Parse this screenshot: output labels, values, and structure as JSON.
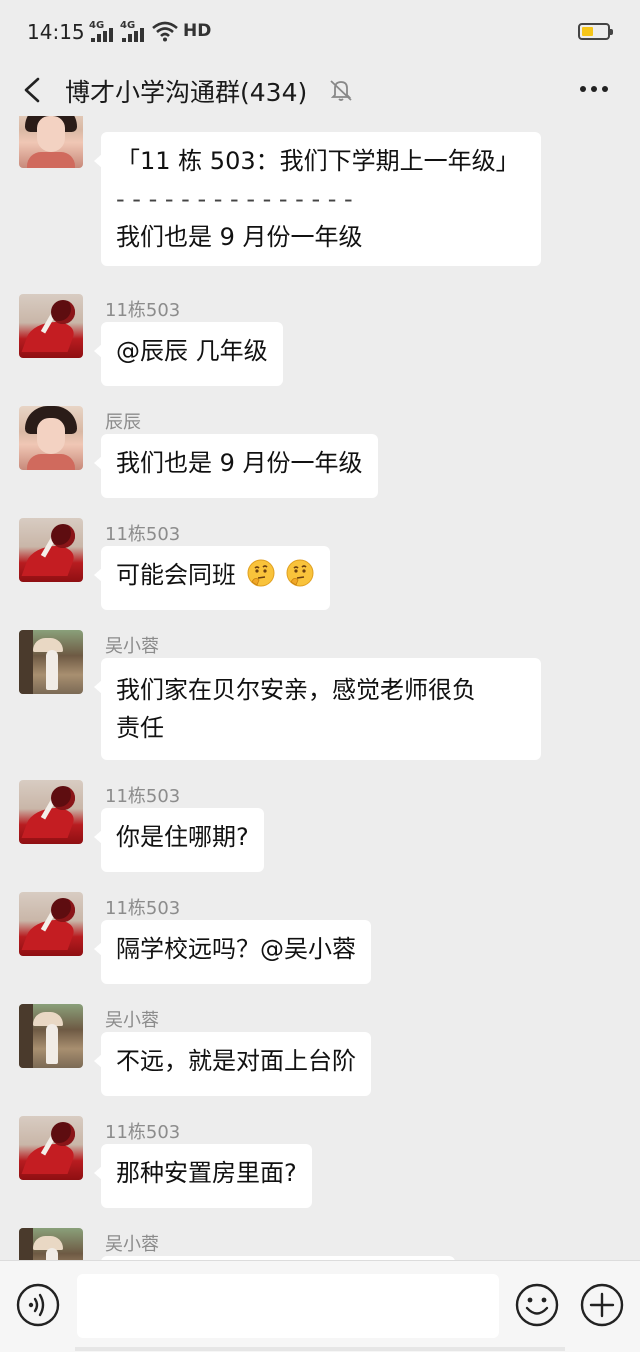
{
  "status": {
    "time": "14:15",
    "signal1": "4G",
    "signal2": "4G",
    "hd": "HD",
    "battery_color": "#f5c518"
  },
  "header": {
    "title": "博才小学沟通群(434)",
    "back_icon": "chevron-left-icon",
    "mute_icon": "bell-off-icon",
    "more_icon": "more-dots-icon"
  },
  "messages": [
    {
      "sender": "",
      "avatar": "girl",
      "lines": [
        "「11 栋 503：我们下学期上一年级」",
        "- - - - - - - - - - - - - - -",
        "我们也是 9 月份一年级"
      ]
    },
    {
      "sender": "11栋503",
      "avatar": "rose",
      "text": "@辰辰  几年级"
    },
    {
      "sender": "辰辰",
      "avatar": "girl",
      "text": "我们也是 9 月份一年级"
    },
    {
      "sender": "11栋503",
      "avatar": "rose",
      "text": "可能会同班",
      "emoji": "thinking-face"
    },
    {
      "sender": "吴小蓉",
      "avatar": "outdoor",
      "lines": [
        "我们家在贝尔安亲，感觉老师很负",
        "责任"
      ]
    },
    {
      "sender": "11栋503",
      "avatar": "rose",
      "text": "你是住哪期?"
    },
    {
      "sender": "11栋503",
      "avatar": "rose",
      "text": "隔学校远吗？@吴小蓉"
    },
    {
      "sender": "吴小蓉",
      "avatar": "outdoor",
      "text": "不远，就是对面上台阶"
    },
    {
      "sender": "11栋503",
      "avatar": "rose",
      "text": "那种安置房里面?"
    },
    {
      "sender": "吴小蓉",
      "avatar": "outdoor",
      "text": ""
    }
  ],
  "input": {
    "placeholder": "",
    "voice_icon": "voice-icon",
    "emoji_icon": "emoji-icon",
    "plus_icon": "plus-icon"
  }
}
